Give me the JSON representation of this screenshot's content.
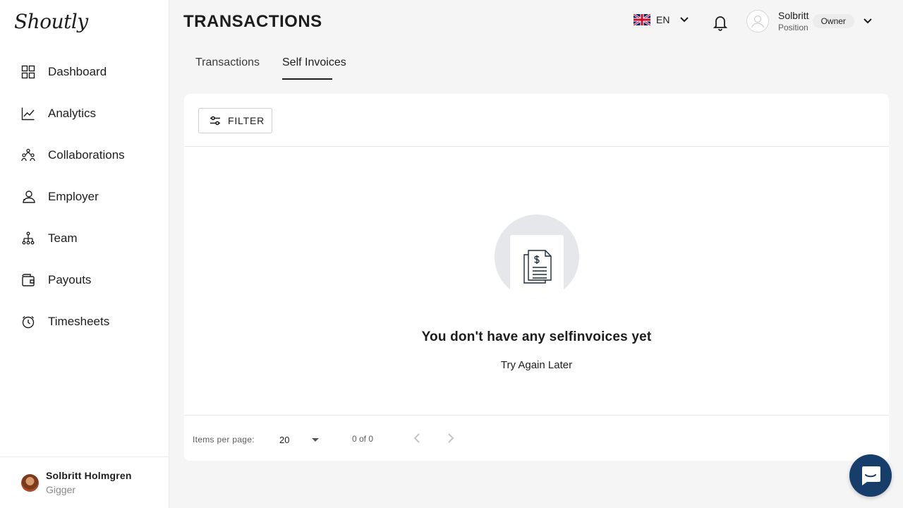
{
  "app": {
    "logo_text": "Shoutly"
  },
  "sidebar": {
    "items": [
      {
        "label": "Dashboard",
        "icon": "grid-icon"
      },
      {
        "label": "Analytics",
        "icon": "chart-line-icon"
      },
      {
        "label": "Collaborations",
        "icon": "collaborations-icon"
      },
      {
        "label": "Employer",
        "icon": "employer-icon"
      },
      {
        "label": "Team",
        "icon": "team-icon"
      },
      {
        "label": "Payouts",
        "icon": "wallet-icon"
      },
      {
        "label": "Timesheets",
        "icon": "stopwatch-icon"
      }
    ],
    "user": {
      "name": "Solbritt Holmgren",
      "role": "Gigger"
    }
  },
  "header": {
    "title": "TRANSACTIONS",
    "language": {
      "code": "EN",
      "flag": "uk-flag-icon"
    },
    "profile": {
      "name": "Solbritt",
      "position": "Position",
      "role": "Owner"
    }
  },
  "tabs": [
    {
      "label": "Transactions",
      "active": false
    },
    {
      "label": "Self Invoices",
      "active": true
    }
  ],
  "toolbar": {
    "filter_label": "FILTER"
  },
  "empty_state": {
    "title": "You don't have any selfinvoices yet",
    "subtitle": "Try Again Later"
  },
  "paginator": {
    "items_per_page_label": "Items per page:",
    "page_size": "20",
    "range": "0 of 0"
  },
  "colors": {
    "chat_button": "#173d6b",
    "accent_dark": "#1d1d1f"
  }
}
